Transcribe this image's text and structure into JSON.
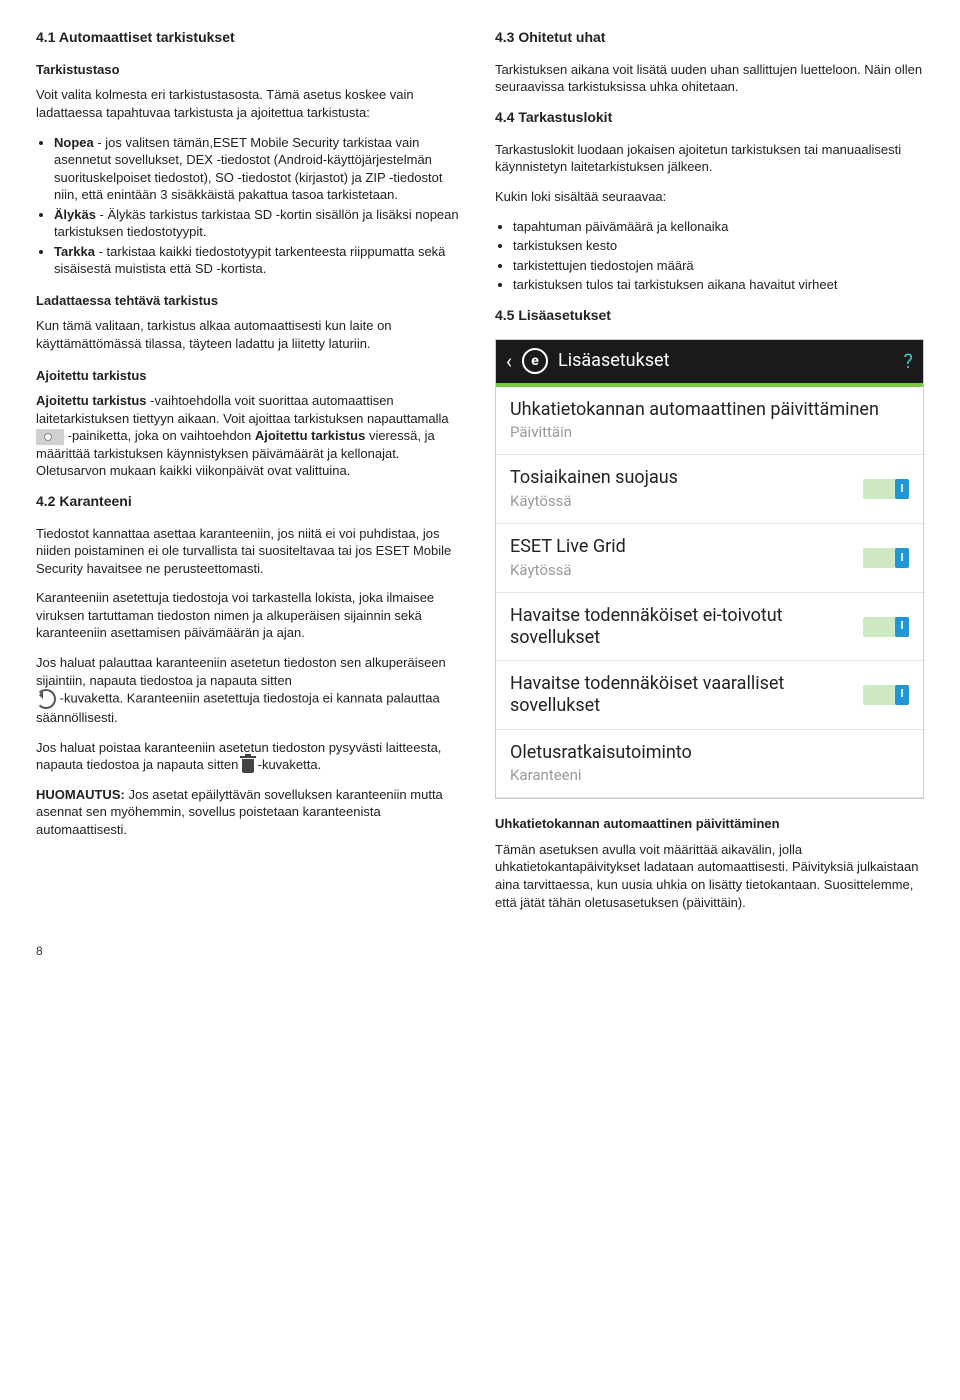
{
  "left": {
    "h_4_1": "4.1   Automaattiset tarkistukset",
    "sub_tarkistustaso": "Tarkistustaso",
    "p1": "Voit valita kolmesta eri tarkistustasosta. Tämä asetus koskee vain ladattaessa tapahtuvaa tarkistusta ja ajoitettua tarkistusta:",
    "li_nopea_b": "Nopea",
    "li_nopea_t": " - jos valitsen tämän,ESET Mobile Security tarkistaa vain asennetut sovellukset, DEX -tiedostot (Android-käyttöjärjestelmän suorituskelpoiset tiedostot), SO -tiedostot (kirjastot) ja ZIP -tiedostot niin, että enintään 3 sisäkkäistä pakattua tasoa tarkistetaan.",
    "li_alykas_b": "Älykäs",
    "li_alykas_t": " - Älykäs tarkistus tarkistaa SD -kortin sisällön ja lisäksi nopean tarkistuksen tiedostotyypit.",
    "li_tarkka_b": "Tarkka",
    "li_tarkka_t": " - tarkistaa kaikki tiedostotyypit tarkenteesta riippumatta sekä sisäisestä muistista että SD -kortista.",
    "sub_ladattaessa": "Ladattaessa tehtävä tarkistus",
    "p_ladattaessa": "Kun tämä valitaan, tarkistus alkaa automaattisesti kun laite on käyttämättömässä tilassa, täyteen ladattu ja liitetty laturiin.",
    "sub_ajoitettu": "Ajoitettu tarkistus",
    "p_ajoitettu_1a": "Ajoitettu tarkistus",
    "p_ajoitettu_1b": " -vaihtoehdolla voit suorittaa automaattisen laitetarkistuksen tiettyyn aikaan. Voit ajoittaa tarkistuksen napauttamalla ",
    "p_ajoitettu_1c": " -painiketta, joka on vaihtoehdon ",
    "p_ajoitettu_1d": "Ajoitettu tarkistus",
    "p_ajoitettu_1e": " vieressä, ja määrittää tarkistuksen käynnistyksen päivämäärät ja kellonajat. Oletusarvon mukaan kaikki viikonpäivät ovat valittuina.",
    "h_4_2": "4.2   Karanteeni",
    "p_kar_1": "Tiedostot kannattaa asettaa karanteeniin, jos niitä ei voi puhdistaa, jos niiden poistaminen ei ole turvallista tai suositeltavaa tai jos ESET Mobile Security havaitsee ne perusteettomasti.",
    "p_kar_2": "Karanteeniin asetettuja tiedostoja voi tarkastella lokista, joka ilmaisee viruksen tartuttaman tiedoston nimen ja alkuperäisen sijainnin sekä karanteeniin asettamisen päivämäärän ja ajan.",
    "p_kar_3a": "Jos haluat palauttaa karanteeniin asetetun tiedoston sen alkuperäiseen sijaintiin, napauta tiedostoa ja napauta sitten ",
    "p_kar_3b": " -kuvaketta. Karanteeniin asetettuja tiedostoja ei kannata palauttaa säännöllisesti.",
    "p_kar_4a": "Jos haluat poistaa karanteeniin asetetun tiedoston pysyvästi laitteesta, napauta tiedostoa ja napauta sitten ",
    "p_kar_4b": " -kuvaketta.",
    "p_kar_5a": "HUOMAUTUS:",
    "p_kar_5b": " Jos asetat epäilyttävän sovelluksen karanteeniin mutta asennat sen myöhemmin, sovellus poistetaan karanteenista automaattisesti."
  },
  "right": {
    "h_4_3": "4.3   Ohitetut uhat",
    "p_4_3": "Tarkistuksen aikana voit lisätä uuden uhan sallittujen luetteloon. Näin ollen seuraavissa tarkistuksissa uhka ohitetaan.",
    "h_4_4": "4.4   Tarkastuslokit",
    "p_4_4_1": "Tarkastuslokit luodaan jokaisen ajoitetun tarkistuksen tai manuaalisesti käynnistetyn laitetarkistuksen jälkeen.",
    "p_4_4_2": "Kukin loki sisältää seuraavaa:",
    "li_4_4_a": "tapahtuman päivämäärä ja kellonaika",
    "li_4_4_b": "tarkistuksen kesto",
    "li_4_4_c": "tarkistettujen tiedostojen määrä",
    "li_4_4_d": "tarkistuksen tulos tai tarkistuksen aikana havaitut virheet",
    "h_4_5": "4.5   Lisäasetukset",
    "phone": {
      "title": "Lisäasetukset",
      "items": [
        {
          "t1": "Uhkatietokannan automaattinen päivittäminen",
          "t2": "Päivittäin",
          "toggle": false
        },
        {
          "t1": "Tosiaikainen suojaus",
          "t2": "Käytössä",
          "toggle": true
        },
        {
          "t1": "ESET Live Grid",
          "t2": "Käytössä",
          "toggle": true
        },
        {
          "t1": "Havaitse todennäköiset ei-toivotut sovellukset",
          "t2": "",
          "toggle": true
        },
        {
          "t1": "Havaitse todennäköiset vaaralliset sovellukset",
          "t2": "",
          "toggle": true
        },
        {
          "t1": "Oletusratkaisutoiminto",
          "t2": "Karanteeni",
          "toggle": false
        }
      ]
    },
    "sub_final": "Uhkatietokannan automaattinen päivittäminen",
    "p_final": "Tämän asetuksen avulla voit määrittää aikavälin, jolla uhkatietokantapäivitykset ladataan automaattisesti. Päivityksiä julkaistaan aina tarvittaessa, kun uusia uhkia on lisätty tietokantaan. Suosittelemme, että jätät tähän oletusasetuksen (päivittäin)."
  },
  "page": "8"
}
